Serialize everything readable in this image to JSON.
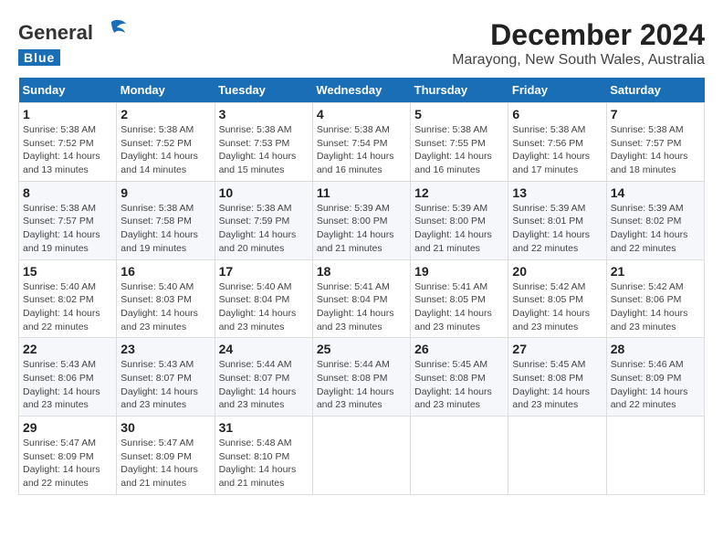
{
  "logo": {
    "general": "General",
    "blue": "Blue"
  },
  "title": "December 2024",
  "subtitle": "Marayong, New South Wales, Australia",
  "weekdays": [
    "Sunday",
    "Monday",
    "Tuesday",
    "Wednesday",
    "Thursday",
    "Friday",
    "Saturday"
  ],
  "weeks": [
    [
      {
        "day": "1",
        "sunrise": "5:38 AM",
        "sunset": "7:52 PM",
        "daylight": "14 hours and 13 minutes."
      },
      {
        "day": "2",
        "sunrise": "5:38 AM",
        "sunset": "7:52 PM",
        "daylight": "14 hours and 14 minutes."
      },
      {
        "day": "3",
        "sunrise": "5:38 AM",
        "sunset": "7:53 PM",
        "daylight": "14 hours and 15 minutes."
      },
      {
        "day": "4",
        "sunrise": "5:38 AM",
        "sunset": "7:54 PM",
        "daylight": "14 hours and 16 minutes."
      },
      {
        "day": "5",
        "sunrise": "5:38 AM",
        "sunset": "7:55 PM",
        "daylight": "14 hours and 16 minutes."
      },
      {
        "day": "6",
        "sunrise": "5:38 AM",
        "sunset": "7:56 PM",
        "daylight": "14 hours and 17 minutes."
      },
      {
        "day": "7",
        "sunrise": "5:38 AM",
        "sunset": "7:57 PM",
        "daylight": "14 hours and 18 minutes."
      }
    ],
    [
      {
        "day": "8",
        "sunrise": "5:38 AM",
        "sunset": "7:57 PM",
        "daylight": "14 hours and 19 minutes."
      },
      {
        "day": "9",
        "sunrise": "5:38 AM",
        "sunset": "7:58 PM",
        "daylight": "14 hours and 19 minutes."
      },
      {
        "day": "10",
        "sunrise": "5:38 AM",
        "sunset": "7:59 PM",
        "daylight": "14 hours and 20 minutes."
      },
      {
        "day": "11",
        "sunrise": "5:39 AM",
        "sunset": "8:00 PM",
        "daylight": "14 hours and 21 minutes."
      },
      {
        "day": "12",
        "sunrise": "5:39 AM",
        "sunset": "8:00 PM",
        "daylight": "14 hours and 21 minutes."
      },
      {
        "day": "13",
        "sunrise": "5:39 AM",
        "sunset": "8:01 PM",
        "daylight": "14 hours and 22 minutes."
      },
      {
        "day": "14",
        "sunrise": "5:39 AM",
        "sunset": "8:02 PM",
        "daylight": "14 hours and 22 minutes."
      }
    ],
    [
      {
        "day": "15",
        "sunrise": "5:40 AM",
        "sunset": "8:02 PM",
        "daylight": "14 hours and 22 minutes."
      },
      {
        "day": "16",
        "sunrise": "5:40 AM",
        "sunset": "8:03 PM",
        "daylight": "14 hours and 23 minutes."
      },
      {
        "day": "17",
        "sunrise": "5:40 AM",
        "sunset": "8:04 PM",
        "daylight": "14 hours and 23 minutes."
      },
      {
        "day": "18",
        "sunrise": "5:41 AM",
        "sunset": "8:04 PM",
        "daylight": "14 hours and 23 minutes."
      },
      {
        "day": "19",
        "sunrise": "5:41 AM",
        "sunset": "8:05 PM",
        "daylight": "14 hours and 23 minutes."
      },
      {
        "day": "20",
        "sunrise": "5:42 AM",
        "sunset": "8:05 PM",
        "daylight": "14 hours and 23 minutes."
      },
      {
        "day": "21",
        "sunrise": "5:42 AM",
        "sunset": "8:06 PM",
        "daylight": "14 hours and 23 minutes."
      }
    ],
    [
      {
        "day": "22",
        "sunrise": "5:43 AM",
        "sunset": "8:06 PM",
        "daylight": "14 hours and 23 minutes."
      },
      {
        "day": "23",
        "sunrise": "5:43 AM",
        "sunset": "8:07 PM",
        "daylight": "14 hours and 23 minutes."
      },
      {
        "day": "24",
        "sunrise": "5:44 AM",
        "sunset": "8:07 PM",
        "daylight": "14 hours and 23 minutes."
      },
      {
        "day": "25",
        "sunrise": "5:44 AM",
        "sunset": "8:08 PM",
        "daylight": "14 hours and 23 minutes."
      },
      {
        "day": "26",
        "sunrise": "5:45 AM",
        "sunset": "8:08 PM",
        "daylight": "14 hours and 23 minutes."
      },
      {
        "day": "27",
        "sunrise": "5:45 AM",
        "sunset": "8:08 PM",
        "daylight": "14 hours and 23 minutes."
      },
      {
        "day": "28",
        "sunrise": "5:46 AM",
        "sunset": "8:09 PM",
        "daylight": "14 hours and 22 minutes."
      }
    ],
    [
      {
        "day": "29",
        "sunrise": "5:47 AM",
        "sunset": "8:09 PM",
        "daylight": "14 hours and 22 minutes."
      },
      {
        "day": "30",
        "sunrise": "5:47 AM",
        "sunset": "8:09 PM",
        "daylight": "14 hours and 21 minutes."
      },
      {
        "day": "31",
        "sunrise": "5:48 AM",
        "sunset": "8:10 PM",
        "daylight": "14 hours and 21 minutes."
      },
      null,
      null,
      null,
      null
    ]
  ]
}
